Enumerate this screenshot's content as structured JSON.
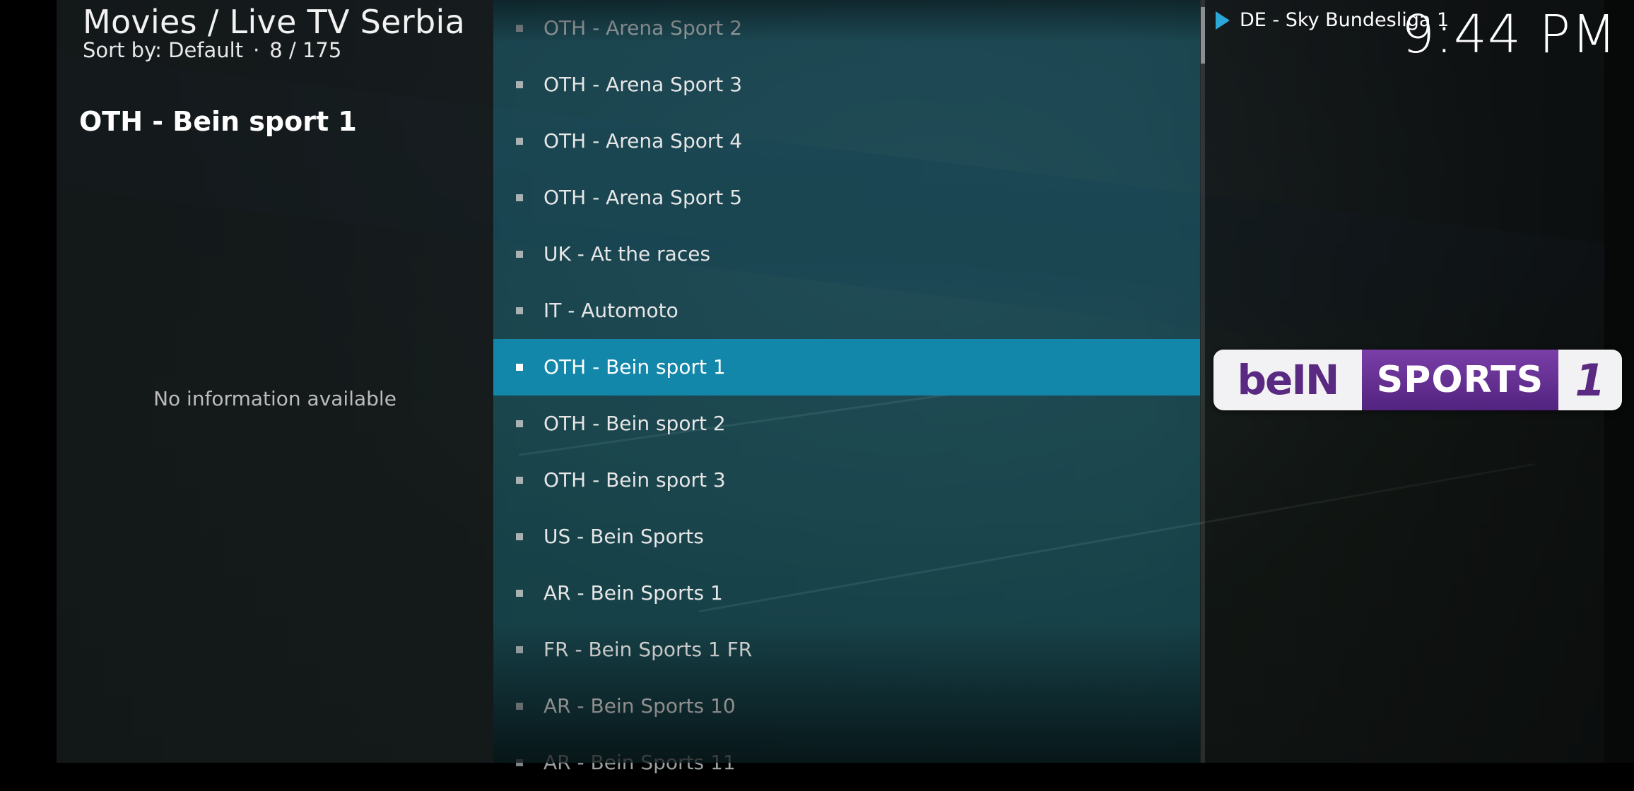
{
  "header": {
    "title": "Movies / Live TV Serbia",
    "sort_label": "Sort by: Default",
    "position": "8 / 175",
    "separator": "·"
  },
  "info_panel": {
    "selected_title": "OTH - Bein sport 1",
    "no_info_text": "No information available"
  },
  "channel_list": {
    "items": [
      {
        "label": "OTH - Arena Sport 2"
      },
      {
        "label": "OTH - Arena Sport 3"
      },
      {
        "label": "OTH - Arena Sport 4"
      },
      {
        "label": "OTH - Arena Sport 5"
      },
      {
        "label": "UK - At the races"
      },
      {
        "label": "IT - Automoto"
      },
      {
        "label": "OTH - Bein sport 1"
      },
      {
        "label": "OTH - Bein sport 2"
      },
      {
        "label": "OTH - Bein sport 3"
      },
      {
        "label": "US - Bein Sports"
      },
      {
        "label": "AR - Bein Sports 1"
      },
      {
        "label": "FR - Bein Sports 1 FR"
      },
      {
        "label": "AR - Bein Sports 10"
      },
      {
        "label": "AR - Bein Sports 11"
      }
    ],
    "selected_index": 6
  },
  "now_playing": {
    "label": "DE - Sky Bundesliga 1",
    "icon": "play-icon"
  },
  "clock": "9:44 PM",
  "channel_logo": {
    "part1": "beIN",
    "part2": "SPORTS",
    "part3": "1"
  },
  "colors": {
    "selection": "#1287aa",
    "play_accent": "#2aa8d8",
    "logo_purple": "#5a2a82"
  }
}
